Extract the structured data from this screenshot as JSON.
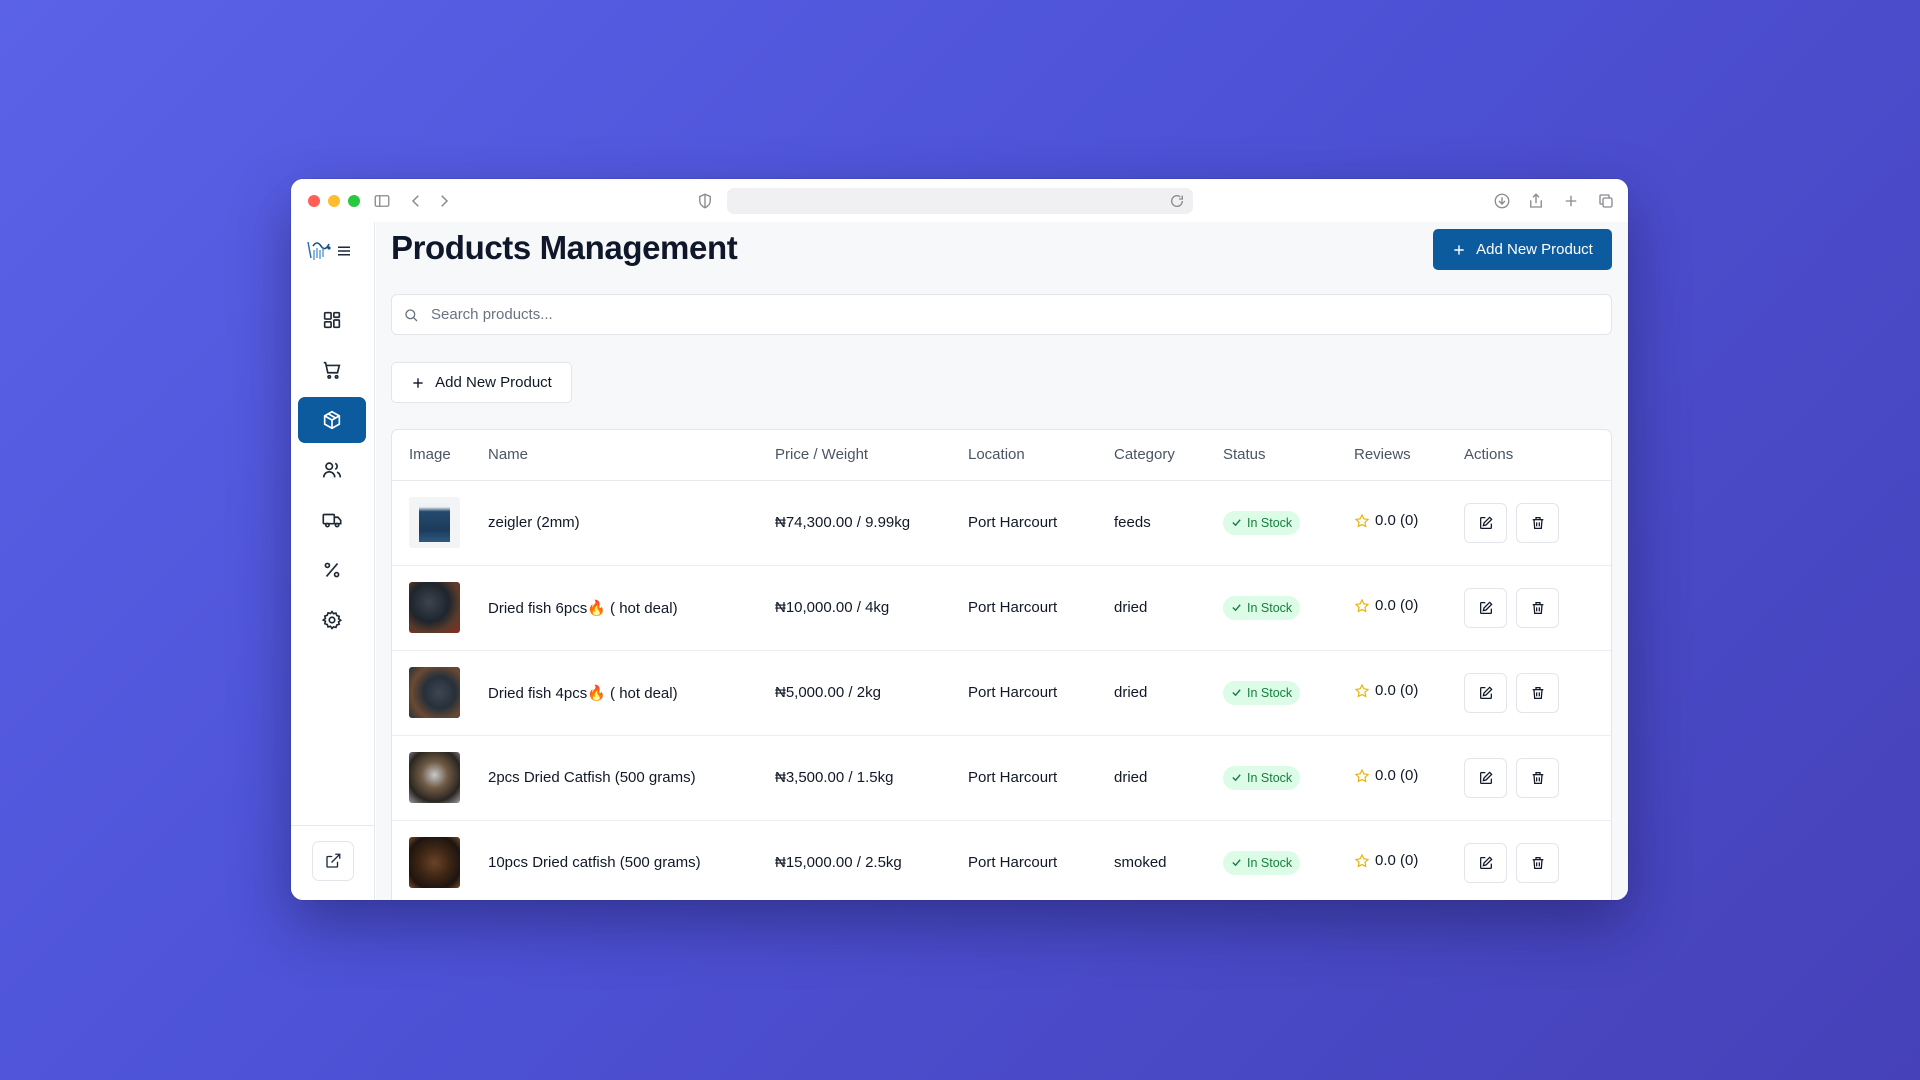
{
  "browser": {
    "url_text": ""
  },
  "page": {
    "title": "Products Management",
    "add_button_label": "Add New Product",
    "secondary_add_button_label": "Add New Product",
    "search_placeholder": "Search products..."
  },
  "sidebar": {
    "items": [
      {
        "name": "dashboard",
        "icon": "grid-icon",
        "active": false
      },
      {
        "name": "orders",
        "icon": "cart-icon",
        "active": false
      },
      {
        "name": "products",
        "icon": "package-icon",
        "active": true
      },
      {
        "name": "customers",
        "icon": "users-icon",
        "active": false
      },
      {
        "name": "delivery",
        "icon": "truck-icon",
        "active": false
      },
      {
        "name": "discounts",
        "icon": "percent-icon",
        "active": false
      },
      {
        "name": "settings",
        "icon": "gear-icon",
        "active": false
      }
    ]
  },
  "table": {
    "headers": [
      "Image",
      "Name",
      "Price / Weight",
      "Location",
      "Category",
      "Status",
      "Reviews",
      "Actions"
    ],
    "rows": [
      {
        "name": "zeigler (2mm)",
        "price_weight": "₦74,300.00 / 9.99kg",
        "location": "Port Harcourt",
        "category": "feeds",
        "status": "In Stock",
        "reviews": "0.0 (0)"
      },
      {
        "name": "Dried fish 6pcs🔥 ( hot deal)",
        "price_weight": "₦10,000.00 / 4kg",
        "location": "Port Harcourt",
        "category": "dried",
        "status": "In Stock",
        "reviews": "0.0 (0)"
      },
      {
        "name": "Dried fish 4pcs🔥 ( hot deal)",
        "price_weight": "₦5,000.00 / 2kg",
        "location": "Port Harcourt",
        "category": "dried",
        "status": "In Stock",
        "reviews": "0.0 (0)"
      },
      {
        "name": "2pcs Dried Catfish (500 grams)",
        "price_weight": "₦3,500.00 / 1.5kg",
        "location": "Port Harcourt",
        "category": "dried",
        "status": "In Stock",
        "reviews": "0.0 (0)"
      },
      {
        "name": "10pcs Dried catfish (500 grams)",
        "price_weight": "₦15,000.00 / 2.5kg",
        "location": "Port Harcourt",
        "category": "smoked",
        "status": "In Stock",
        "reviews": "0.0 (0)"
      }
    ]
  },
  "colors": {
    "primary": "#0b5b9e",
    "status_bg": "#dcfce7",
    "status_text": "#15803d",
    "star": "#eab308"
  }
}
